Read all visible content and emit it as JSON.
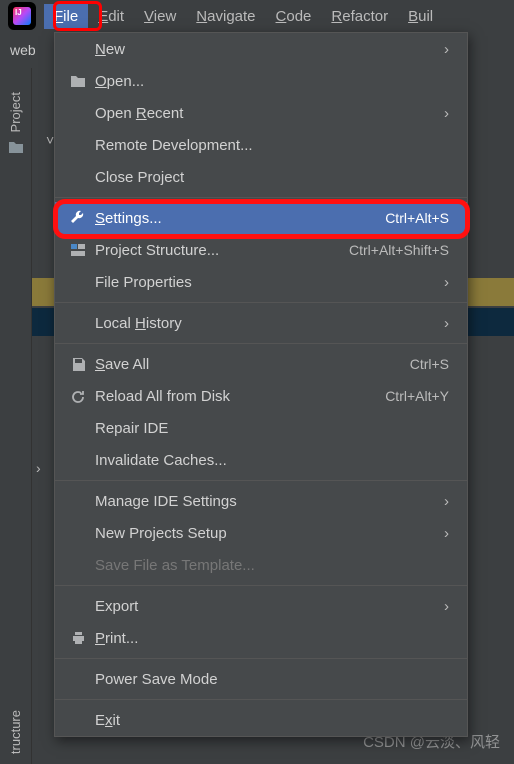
{
  "menubar": {
    "items": [
      {
        "pre": "",
        "ul": "F",
        "post": "ile",
        "active": true
      },
      {
        "pre": "",
        "ul": "E",
        "post": "dit"
      },
      {
        "pre": "",
        "ul": "V",
        "post": "iew"
      },
      {
        "pre": "",
        "ul": "N",
        "post": "avigate"
      },
      {
        "pre": "",
        "ul": "C",
        "post": "ode"
      },
      {
        "pre": "",
        "ul": "R",
        "post": "efactor"
      },
      {
        "pre": "",
        "ul": "B",
        "post": "uil"
      }
    ]
  },
  "toolbar": {
    "context": "web"
  },
  "rails": {
    "project": "Project",
    "structure": "tructure"
  },
  "dropdown": {
    "groups": [
      [
        {
          "icon": "",
          "pre": "",
          "ul": "N",
          "post": "ew",
          "shortcut": "",
          "submenu": true
        },
        {
          "icon": "folder",
          "pre": "",
          "ul": "O",
          "post": "pen...",
          "shortcut": "",
          "submenu": false
        },
        {
          "icon": "",
          "pre": "Open ",
          "ul": "R",
          "post": "ecent",
          "shortcut": "",
          "submenu": true
        },
        {
          "icon": "",
          "pre": "Remote Development...",
          "ul": "",
          "post": "",
          "shortcut": "",
          "submenu": false
        },
        {
          "icon": "",
          "pre": "Close Pro",
          "ul": "j",
          "post": "ect",
          "shortcut": "",
          "submenu": false
        }
      ],
      [
        {
          "icon": "wrench",
          "pre": "",
          "ul": "S",
          "post": "ettings...",
          "shortcut": "Ctrl+Alt+S",
          "submenu": false,
          "selected": true
        },
        {
          "icon": "structure",
          "pre": "Project Structure...",
          "ul": "",
          "post": "",
          "shortcut": "Ctrl+Alt+Shift+S",
          "submenu": false
        },
        {
          "icon": "",
          "pre": "File Properties",
          "ul": "",
          "post": "",
          "shortcut": "",
          "submenu": true
        }
      ],
      [
        {
          "icon": "",
          "pre": "Local ",
          "ul": "H",
          "post": "istory",
          "shortcut": "",
          "submenu": true
        }
      ],
      [
        {
          "icon": "save",
          "pre": "",
          "ul": "S",
          "post": "ave All",
          "shortcut": "Ctrl+S",
          "submenu": false
        },
        {
          "icon": "reload",
          "pre": "Reload All from Disk",
          "ul": "",
          "post": "",
          "shortcut": "Ctrl+Alt+Y",
          "submenu": false
        },
        {
          "icon": "",
          "pre": "Repair IDE",
          "ul": "",
          "post": "",
          "shortcut": "",
          "submenu": false
        },
        {
          "icon": "",
          "pre": "Invalidate Caches...",
          "ul": "",
          "post": "",
          "shortcut": "",
          "submenu": false
        }
      ],
      [
        {
          "icon": "",
          "pre": "Manage IDE Settings",
          "ul": "",
          "post": "",
          "shortcut": "",
          "submenu": true
        },
        {
          "icon": "",
          "pre": "New Projects Setup",
          "ul": "",
          "post": "",
          "shortcut": "",
          "submenu": true
        },
        {
          "icon": "",
          "pre": "Save File as Template...",
          "ul": "",
          "post": "",
          "shortcut": "",
          "submenu": false,
          "disabled": true
        }
      ],
      [
        {
          "icon": "",
          "pre": "Export",
          "ul": "",
          "post": "",
          "shortcut": "",
          "submenu": true
        },
        {
          "icon": "print",
          "pre": "",
          "ul": "P",
          "post": "rint...",
          "shortcut": "",
          "submenu": false
        }
      ],
      [
        {
          "icon": "",
          "pre": "Power Save Mode",
          "ul": "",
          "post": "",
          "shortcut": "",
          "submenu": false
        }
      ],
      [
        {
          "icon": "",
          "pre": "E",
          "ul": "x",
          "post": "it",
          "shortcut": "",
          "submenu": false
        }
      ]
    ]
  },
  "watermark": "CSDN @云淡、风轻"
}
